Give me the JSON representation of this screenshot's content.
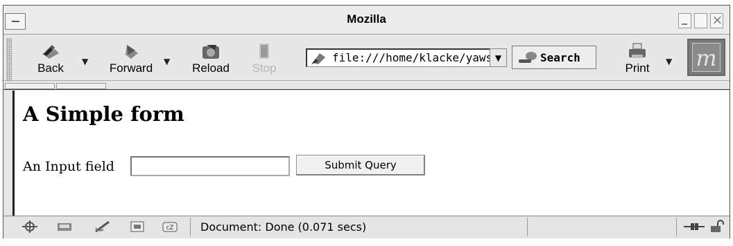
{
  "window": {
    "title": "Mozilla"
  },
  "toolbar": {
    "back_label": "Back",
    "forward_label": "Forward",
    "reload_label": "Reload",
    "stop_label": "Stop",
    "print_label": "Print",
    "search_label": "Search"
  },
  "address_bar": {
    "url": "file:///home/klacke/yaws"
  },
  "logo": {
    "letter": "m"
  },
  "page": {
    "title": "A Simple form",
    "field_label": "An Input field",
    "input_value": "",
    "submit_label": "Submit Query"
  },
  "status_bar": {
    "text": "Document: Done (0.071 secs)"
  },
  "colors": {
    "accent_disabled": "#b6b6b6",
    "logo_bg": "#7a7a7a"
  }
}
